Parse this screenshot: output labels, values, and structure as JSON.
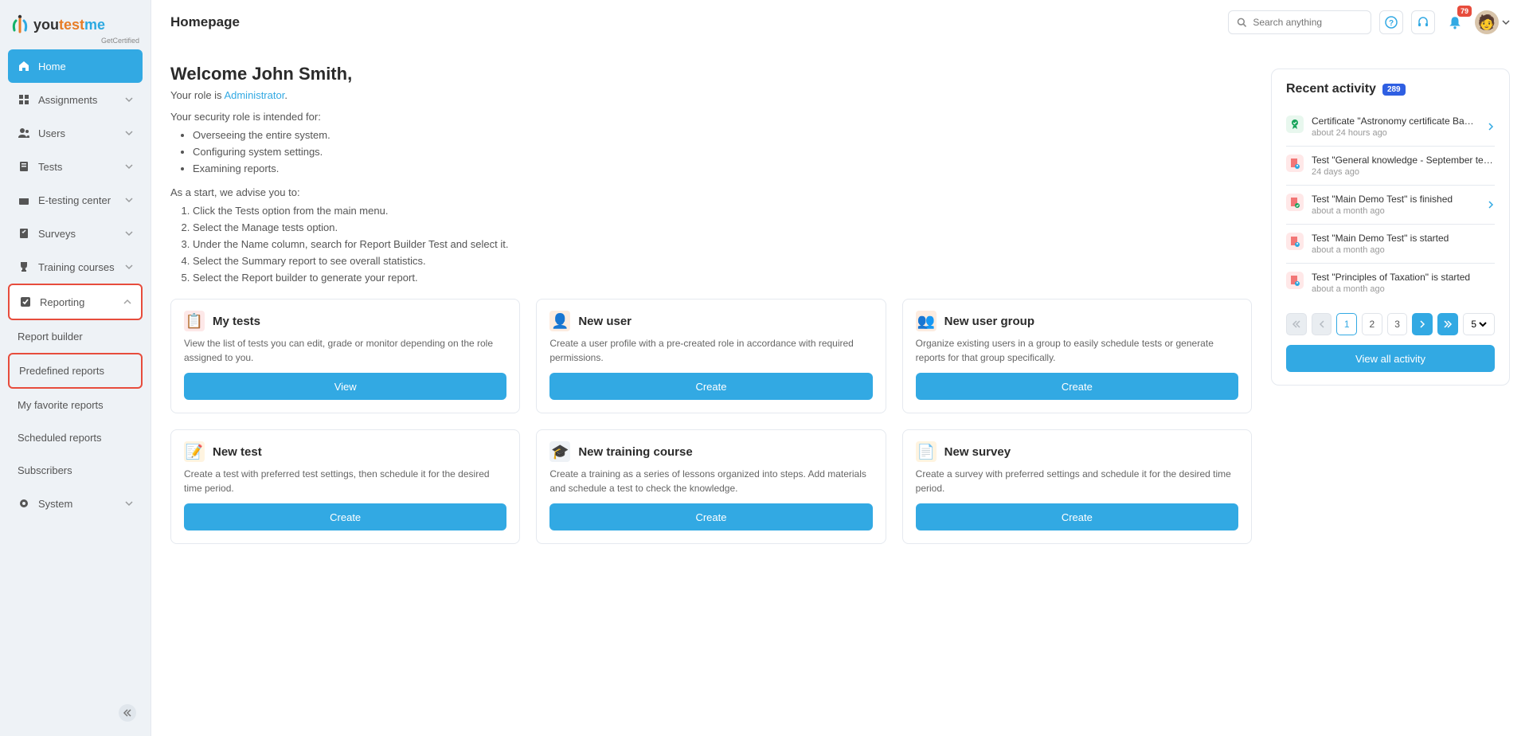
{
  "brand": {
    "you": "you",
    "test": "test",
    "me": "me",
    "sub": "GetCertified"
  },
  "search": {
    "placeholder": "Search anything"
  },
  "notifications": {
    "count": "79"
  },
  "page": {
    "title": "Homepage"
  },
  "sidebar": {
    "items": [
      {
        "label": "Home"
      },
      {
        "label": "Assignments"
      },
      {
        "label": "Users"
      },
      {
        "label": "Tests"
      },
      {
        "label": "E-testing center"
      },
      {
        "label": "Surveys"
      },
      {
        "label": "Training courses"
      },
      {
        "label": "Reporting"
      },
      {
        "label": "System"
      }
    ],
    "reporting_sub": [
      {
        "label": "Report builder"
      },
      {
        "label": "Predefined reports"
      },
      {
        "label": "My favorite reports"
      },
      {
        "label": "Scheduled reports"
      },
      {
        "label": "Subscribers"
      }
    ]
  },
  "welcome": {
    "heading": "Welcome John Smith,",
    "role_prefix": "Your role is ",
    "role": "Administrator",
    "role_suffix": ".",
    "intended": "Your security role is intended for:",
    "bullets": [
      "Overseeing the entire system.",
      "Configuring system settings.",
      "Examining reports."
    ],
    "start": "As a start, we advise you to:",
    "steps": [
      "Click the Tests option from the main menu.",
      "Select the Manage tests option.",
      "Under the Name column, search for Report Builder Test and select it.",
      "Select the Summary report to see overall statistics.",
      "Select the Report builder to generate your report."
    ]
  },
  "cards": [
    {
      "title": "My tests",
      "desc": "View the list of tests you can edit, grade or monitor depending on the role assigned to you.",
      "button": "View",
      "icon": "📋",
      "bg": "#fde8e8"
    },
    {
      "title": "New user",
      "desc": "Create a user profile with a pre-created role in accordance with required permissions.",
      "button": "Create",
      "icon": "👤",
      "bg": "#fdece0"
    },
    {
      "title": "New user group",
      "desc": "Organize existing users in a group to easily schedule tests or generate reports for that group specifically.",
      "button": "Create",
      "icon": "👥",
      "bg": "#fdece0"
    },
    {
      "title": "New test",
      "desc": "Create a test with preferred test settings, then schedule it for the desired time period.",
      "button": "Create",
      "icon": "📝",
      "bg": "#fff4e0"
    },
    {
      "title": "New training course",
      "desc": "Create a training as a series of lessons organized into steps. Add materials and schedule a test to check the knowledge.",
      "button": "Create",
      "icon": "🎓",
      "bg": "#eef2f6"
    },
    {
      "title": "New survey",
      "desc": "Create a survey with preferred settings and schedule it for the desired time period.",
      "button": "Create",
      "icon": "📄",
      "bg": "#fff4e0"
    }
  ],
  "recent": {
    "title": "Recent activity",
    "count": "289",
    "view_all": "View all activity",
    "items": [
      {
        "title": "Certificate \"Astronomy certificate Basic\" is updat…",
        "time": "about 24 hours ago",
        "kind": "cert",
        "link": true
      },
      {
        "title": "Test \"General knowledge - September test\" is star…",
        "time": "24 days ago",
        "kind": "test",
        "link": false
      },
      {
        "title": "Test \"Main Demo Test\" is finished",
        "time": "about a month ago",
        "kind": "test-done",
        "link": true
      },
      {
        "title": "Test \"Main Demo Test\" is started",
        "time": "about a month ago",
        "kind": "test",
        "link": false
      },
      {
        "title": "Test \"Principles of Taxation\" is started",
        "time": "about a month ago",
        "kind": "test",
        "link": false
      }
    ],
    "pages": [
      "1",
      "2",
      "3"
    ],
    "page_size": "5"
  }
}
